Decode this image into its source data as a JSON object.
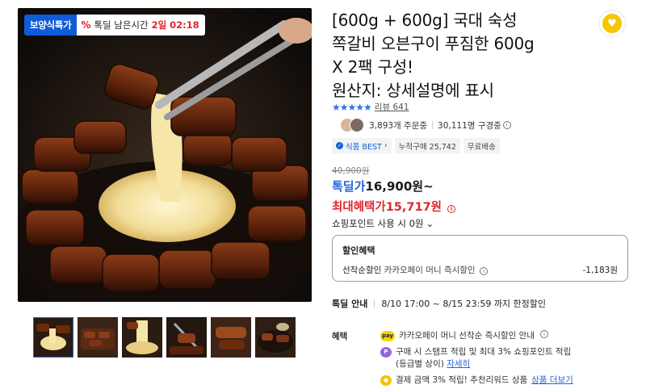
{
  "badge": {
    "label": "보양식특가",
    "pct_icon": "%",
    "timer_label": "톡딜 남은시간",
    "timer_value": "2일 02:18"
  },
  "thumbnails": [
    {
      "name": "thumb-1",
      "icon": "cheese-ribs-photo"
    },
    {
      "name": "thumb-2",
      "icon": "ribs-tray-photo"
    },
    {
      "name": "thumb-3",
      "icon": "cheese-pull-photo"
    },
    {
      "name": "thumb-4",
      "icon": "ribs-tongs-photo"
    },
    {
      "name": "thumb-5",
      "icon": "ribs-closeup-photo"
    },
    {
      "name": "thumb-6",
      "icon": "ribs-plate-photo"
    }
  ],
  "product": {
    "title_lines": [
      "[600g + 600g] 국대 숙성",
      "쪽갈비 오븐구이 푸짐한 600g",
      "X 2팩 구성!",
      "원산지: 상세설명에 표시"
    ],
    "stars": "★★★★★",
    "review_text": "리뷰 641",
    "buyers_text": "3,893개 주문중",
    "viewers_text": "30,111명 구경중",
    "tags": [
      "식품 BEST",
      "누적구매 25,742",
      "무료배송"
    ],
    "original_price": "40,900원",
    "deal_label": "톡딜가",
    "deal_price": "16,900원~",
    "max_label": "최대혜택가",
    "max_price": "15,717원",
    "point_text": "쇼핑포인트 사용 시 0원"
  },
  "discount_box": {
    "title": "할인혜택",
    "row_label": "선착순할인",
    "row_sub": "카카오페이 머니 즉시할인",
    "row_value": "-1,183원"
  },
  "period": {
    "label": "톡딜 안내",
    "value": "8/10 17:00 ~ 8/15 23:59 까지 한정할인"
  },
  "benefit": {
    "label": "혜택",
    "line1": "카카오페이 머니 선착순 즉시할인 안내",
    "line2a": "구매 시 스탬프 적립 및 최대 3% 쇼핑포인트 적립",
    "line2b": "(등급별 상이)",
    "line2_link": "자세히",
    "line3": "결제 금액 3% 적립! 추천리워드 상품",
    "line3_link": "상품 더보기"
  },
  "colors": {
    "accent_blue": "#2364d8",
    "sale_red": "#e0262d",
    "badge_blue": "#0f5bd8"
  }
}
